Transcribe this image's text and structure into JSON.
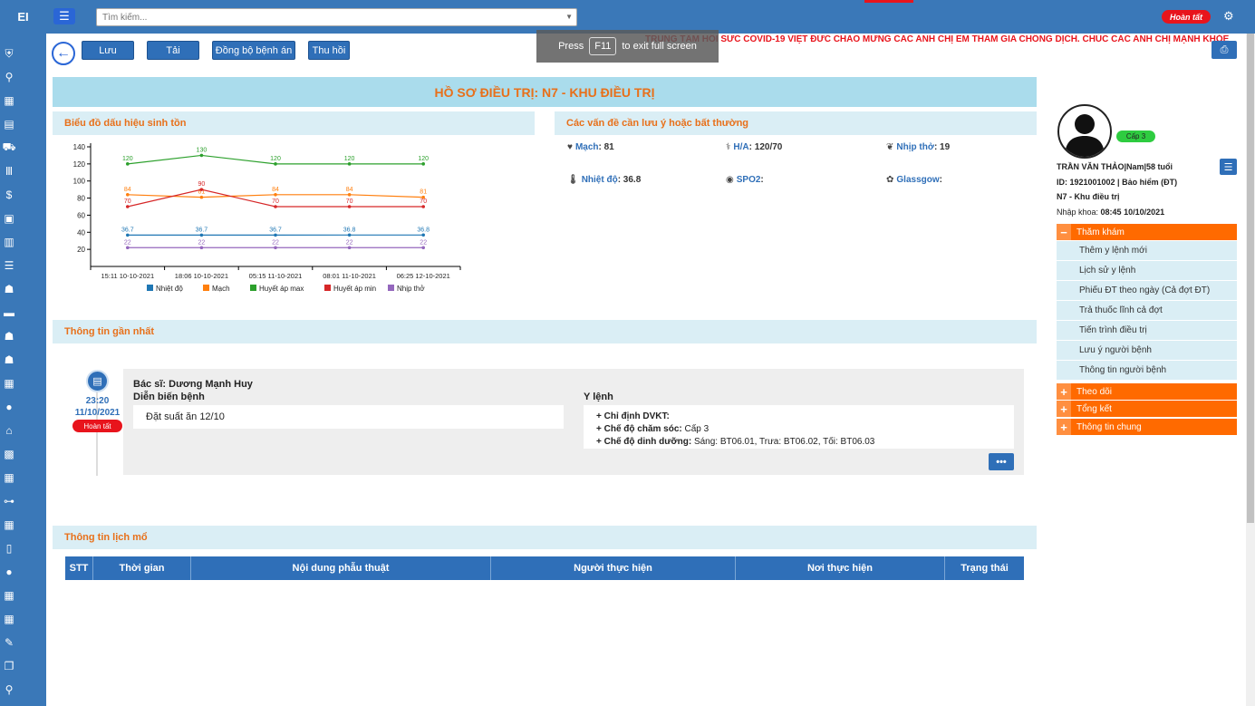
{
  "app": {
    "logo": "EI"
  },
  "topbar": {
    "search_placeholder": "Tìm kiếm...",
    "status": "Hoàn tất"
  },
  "toolbar": {
    "save": "Lưu",
    "reload": "Tải",
    "sync": "Đồng bộ bệnh án",
    "revoke": "Thu hồi"
  },
  "fullscreen": {
    "press": "Press",
    "key": "F11",
    "rest": "to exit full screen"
  },
  "marquee": "TRUNG TÂM HỒI SỨC COVID-19 VIỆT ĐỨC CHÀO MỪNG CÁC ANH CHỊ EM THAM GIA CHỐNG DỊCH. CHÚC CÁC ANH CHỊ MẠNH KHỎE",
  "page_title": "HỒ SƠ ĐIỀU TRỊ: N7 - KHU ĐIỀU TRỊ",
  "vitals_chart": {
    "header": "Biểu đồ dấu hiệu sinh tồn"
  },
  "chart_data": {
    "type": "line",
    "x": [
      "15:11 10-10-2021",
      "18:06 10-10-2021",
      "05:15 11-10-2021",
      "08:01 11-10-2021",
      "06:25 12-10-2021"
    ],
    "ylim": [
      0,
      140
    ],
    "yticks": [
      20,
      40,
      60,
      80,
      100,
      120,
      140
    ],
    "series": [
      {
        "name": "Nhiệt độ",
        "color": "#1f77b4",
        "values": [
          36.7,
          36.7,
          36.7,
          36.8,
          36.8
        ]
      },
      {
        "name": "Mạch",
        "color": "#ff7f0e",
        "values": [
          84,
          81,
          84,
          84,
          81
        ]
      },
      {
        "name": "Huyết áp max",
        "color": "#2ca02c",
        "values": [
          120,
          130,
          120,
          120,
          120
        ]
      },
      {
        "name": "Huyết áp min",
        "color": "#d62728",
        "values": [
          70,
          90,
          70,
          70,
          70
        ]
      },
      {
        "name": "Nhịp thở",
        "color": "#9467bd",
        "values": [
          22,
          22,
          22,
          22,
          22
        ]
      }
    ],
    "legend": "bottom",
    "grid": false
  },
  "abnormal": {
    "header": "Các vấn đề cần lưu ý hoặc bất thường",
    "items": [
      {
        "label": "Mạch",
        "value": ": 81"
      },
      {
        "label": "H/A",
        "value": ": 120/70"
      },
      {
        "label": "Nhịp thở",
        "value": ": 19"
      },
      {
        "label": "Nhiệt độ",
        "value": ": 36.8"
      },
      {
        "label": "SPO2",
        "value": ":"
      },
      {
        "label": "Glassgow",
        "value": ":"
      }
    ]
  },
  "recent": {
    "header": "Thông tin gần nhất",
    "time": "23:20",
    "date": "11/10/2021",
    "status": "Hoàn tất",
    "doctor": "Bác sĩ: Dương Mạnh Huy",
    "progress_label": "Diễn biến bệnh",
    "progress_text": "Đặt suất ăn 12/10",
    "orders_label": "Y lệnh",
    "order1_label": "+ Chỉ định DVKT:",
    "order2_label": "+ Chế độ chăm sóc:",
    "order2_value": " Cấp 3",
    "order3_label": "+ Chế độ dinh dưỡng:",
    "order3_value": " Sáng: BT06.01, Trưa: BT06.02, Tối: BT06.03",
    "more": "•••"
  },
  "surgery": {
    "header": "Thông tin lịch mổ",
    "columns": [
      "STT",
      "Thời gian",
      "Nội dung phẫu thuật",
      "Người thực hiện",
      "Nơi thực hiện",
      "Trạng thái"
    ]
  },
  "patient": {
    "level": "Cấp 3",
    "name_line": "TRẦN VĂN THẢO|Nam|58 tuổi",
    "id_line": "ID: 1921001002 | Bảo hiểm (ĐT)",
    "ward": "N7 - Khu điều trị",
    "admit_label": "Nhập khoa: ",
    "admit_value": "08:45 10/10/2021"
  },
  "accordion": {
    "exam": "Thăm khám",
    "exam_items": [
      "Thêm y lệnh mới",
      "Lịch sử y lệnh",
      "Phiếu ĐT theo ngày (Cả đợt ĐT)",
      "Trả thuốc lĩnh cả đợt",
      "Tiến trình điều trị",
      "Lưu ý người bệnh",
      "Thông tin người bệnh"
    ],
    "follow": "Theo dõi",
    "summary": "Tổng kết",
    "general": "Thông tin chung"
  }
}
